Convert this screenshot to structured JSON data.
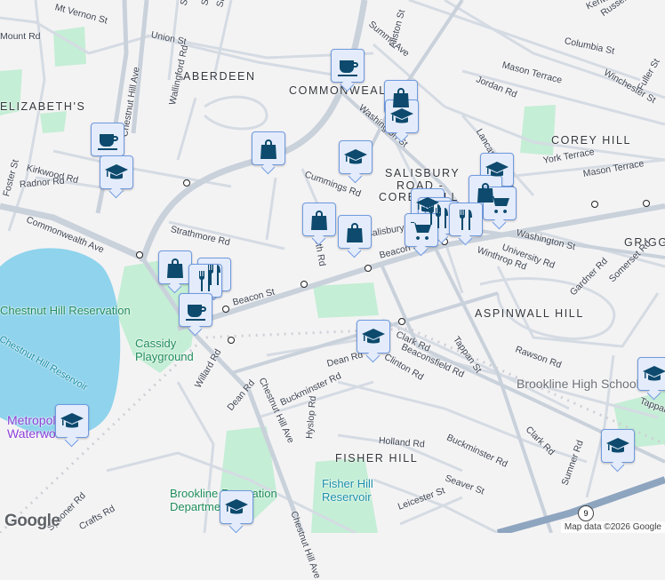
{
  "neighborhoods": [
    "ABERDEEN",
    "COMMONWEALTH",
    "ELIZABETH'S",
    "SALISBURY",
    "ROAD -",
    "COREY HILL",
    "COREY HILL",
    "GRIGGS",
    "ASPINWALL HILL",
    "FISHER HILL"
  ],
  "streets": [
    "Mt Vernon St",
    "Union St",
    "Shepard St",
    "Shannon St",
    "Snow St",
    "Chestnut Hill Ave",
    "Wallingford Rd",
    "Foster St",
    "Kirkwood Rd",
    "Radnor Rd",
    "Commonwealth Ave",
    "Strathmore Rd",
    "Cummings Rd",
    "Summit Ave",
    "Allston St",
    "Washington St",
    "Mason Terrace",
    "Jordan Rd",
    "Columbia St",
    "Winchester St",
    "Russell St",
    "Kenwood St",
    "Lancaster Terrace",
    "York Terrace",
    "Mason Terrace",
    "Washington St",
    "University Rd",
    "Winthrop Rd",
    "Beacon St",
    "Beacon St",
    "Beaconsfield Rd",
    "Tappan St",
    "Rawson Rd",
    "Gardner Rd",
    "Somerset Rd",
    "Clark Rd",
    "Dean Rd",
    "Clinton Rd",
    "Willard Rd",
    "Dean Rd",
    "Chestnut Hill Ave",
    "Buckminster Rd",
    "Hyslop Rd",
    "Holland Rd",
    "Buckminster Rd",
    "Clark Rd",
    "Sumner Rd",
    "Seaver St",
    "Leicester St",
    "Spooner Rd",
    "Crafts Rd",
    "Salisbury Rd",
    "Chestnut Hill Ave",
    "Tappan St",
    "Fuller St",
    "Mount Rd",
    "Sth Rd"
  ],
  "places": {
    "reservation": "Chestnut Hill Reservation",
    "reservoir": "Chestnut Hill Reservoir",
    "playground": "Cassidy Playground",
    "museum": "Metropolitan Waterworks Museum",
    "school": "Brookline High School",
    "recreation": "Brookline Recreation Department",
    "fisher_reservoir": "Fisher Hill Reservoir"
  },
  "route_shield": "9",
  "markers": [
    "coffee-icon",
    "graduation-cap-icon",
    "coffee-icon",
    "shopping-bag-icon",
    "graduation-cap-icon",
    "shopping-bag-icon",
    "graduation-cap-icon",
    "graduation-cap-icon",
    "shopping-bag-icon",
    "shopping-bag-icon",
    "graduation-cap-icon",
    "shopping-bag-icon",
    "shopping-cart-icon",
    "restaurant-icon",
    "restaurant-icon",
    "shopping-cart-icon",
    "restaurant-icon",
    "shopping-bag-icon",
    "restaurant-icon",
    "restaurant-icon",
    "coffee-icon",
    "graduation-cap-icon",
    "graduation-cap-icon",
    "graduation-cap-icon",
    "graduation-cap-icon",
    "graduation-cap-icon"
  ],
  "attribution": "Map data ©2026 Google",
  "logo": "Google",
  "colors": {
    "marker_bg": "#e4ecfb",
    "marker_border": "#6f9ae0",
    "icon": "#0d4a6e",
    "park": "#c4eed5",
    "water": "#8fd3ec"
  }
}
